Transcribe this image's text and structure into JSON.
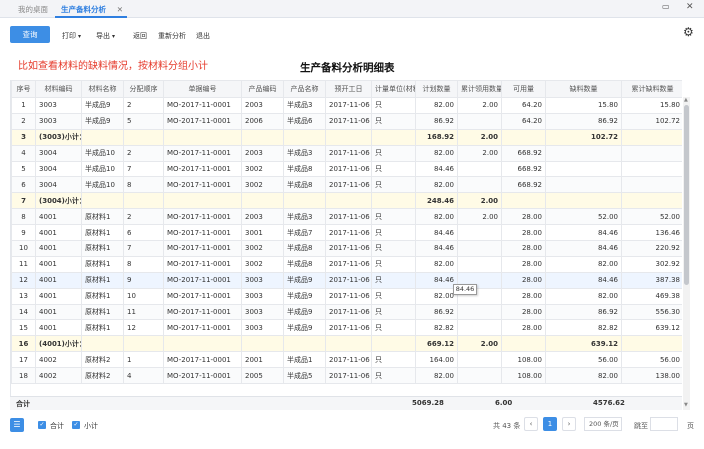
{
  "tabs": {
    "home": "我的桌面",
    "active": "生产备料分析",
    "close": "✕"
  },
  "window": {
    "min": "▭",
    "close": "✕"
  },
  "toolbar": {
    "query": "查询",
    "print": "打印",
    "export": "导出",
    "back": "返回",
    "reanalyze": "重新分析",
    "exit": "退出",
    "gear_icon": "gear-icon"
  },
  "note": "比如查看材料的缺料情况，按材料分组小计",
  "title": "生产备料分析明细表",
  "columns": [
    "序号",
    "材料编码",
    "材料名称",
    "分配顺序",
    "单据编号",
    "产品编码",
    "产品名称",
    "预开工日",
    "计量单位(材料)",
    "计划数量",
    "累计领用数量",
    "可用量",
    "缺料数量",
    "累计缺料数量"
  ],
  "rows": [
    {
      "type": "data",
      "cells": [
        "1",
        "3003",
        "半成品9",
        "2",
        "MO-2017-11-0001",
        "2003",
        "半成品3",
        "2017-11-06",
        "只",
        "82.00",
        "2.00",
        "64.20",
        "15.80",
        "15.80"
      ]
    },
    {
      "type": "data",
      "cells": [
        "2",
        "3003",
        "半成品9",
        "5",
        "MO-2017-11-0001",
        "2006",
        "半成品6",
        "2017-11-06",
        "只",
        "86.92",
        "",
        "64.20",
        "86.92",
        "102.72"
      ]
    },
    {
      "type": "subtotal",
      "cells": [
        "3",
        "(3003)小计：",
        "",
        "",
        "",
        "",
        "",
        "",
        "",
        "168.92",
        "2.00",
        "",
        "102.72",
        ""
      ]
    },
    {
      "type": "data",
      "cells": [
        "4",
        "3004",
        "半成品10",
        "2",
        "MO-2017-11-0001",
        "2003",
        "半成品3",
        "2017-11-06",
        "只",
        "82.00",
        "2.00",
        "668.92",
        "",
        ""
      ]
    },
    {
      "type": "data",
      "cells": [
        "5",
        "3004",
        "半成品10",
        "7",
        "MO-2017-11-0001",
        "3002",
        "半成品8",
        "2017-11-06",
        "只",
        "84.46",
        "",
        "668.92",
        "",
        ""
      ]
    },
    {
      "type": "data",
      "cells": [
        "6",
        "3004",
        "半成品10",
        "8",
        "MO-2017-11-0001",
        "3002",
        "半成品8",
        "2017-11-06",
        "只",
        "82.00",
        "",
        "668.92",
        "",
        ""
      ]
    },
    {
      "type": "subtotal",
      "cells": [
        "7",
        "(3004)小计：",
        "",
        "",
        "",
        "",
        "",
        "",
        "",
        "248.46",
        "2.00",
        "",
        "",
        ""
      ]
    },
    {
      "type": "data",
      "cells": [
        "8",
        "4001",
        "原材料1",
        "2",
        "MO-2017-11-0001",
        "2003",
        "半成品3",
        "2017-11-06",
        "只",
        "82.00",
        "2.00",
        "28.00",
        "52.00",
        "52.00"
      ]
    },
    {
      "type": "data",
      "cells": [
        "9",
        "4001",
        "原材料1",
        "6",
        "MO-2017-11-0001",
        "3001",
        "半成品7",
        "2017-11-06",
        "只",
        "84.46",
        "",
        "28.00",
        "84.46",
        "136.46"
      ]
    },
    {
      "type": "data",
      "cells": [
        "10",
        "4001",
        "原材料1",
        "7",
        "MO-2017-11-0001",
        "3002",
        "半成品8",
        "2017-11-06",
        "只",
        "84.46",
        "",
        "28.00",
        "84.46",
        "220.92"
      ]
    },
    {
      "type": "data",
      "cells": [
        "11",
        "4001",
        "原材料1",
        "8",
        "MO-2017-11-0001",
        "3002",
        "半成品8",
        "2017-11-06",
        "只",
        "82.00",
        "",
        "28.00",
        "82.00",
        "302.92"
      ]
    },
    {
      "type": "hl",
      "cells": [
        "12",
        "4001",
        "原材料1",
        "9",
        "MO-2017-11-0001",
        "3003",
        "半成品9",
        "2017-11-06",
        "只",
        "84.46",
        "",
        "28.00",
        "84.46",
        "387.38"
      ]
    },
    {
      "type": "data",
      "cells": [
        "13",
        "4001",
        "原材料1",
        "10",
        "MO-2017-11-0001",
        "3003",
        "半成品9",
        "2017-11-06",
        "只",
        "82.00",
        "",
        "28.00",
        "82.00",
        "469.38"
      ]
    },
    {
      "type": "data",
      "cells": [
        "14",
        "4001",
        "原材料1",
        "11",
        "MO-2017-11-0001",
        "3003",
        "半成品9",
        "2017-11-06",
        "只",
        "86.92",
        "",
        "28.00",
        "86.92",
        "556.30"
      ]
    },
    {
      "type": "data",
      "cells": [
        "15",
        "4001",
        "原材料1",
        "12",
        "MO-2017-11-0001",
        "3003",
        "半成品9",
        "2017-11-06",
        "只",
        "82.82",
        "",
        "28.00",
        "82.82",
        "639.12"
      ]
    },
    {
      "type": "subtotal",
      "cells": [
        "16",
        "(4001)小计：",
        "",
        "",
        "",
        "",
        "",
        "",
        "",
        "669.12",
        "2.00",
        "",
        "639.12",
        ""
      ]
    },
    {
      "type": "data",
      "cells": [
        "17",
        "4002",
        "原材料2",
        "1",
        "MO-2017-11-0001",
        "2001",
        "半成品1",
        "2017-11-06",
        "只",
        "164.00",
        "",
        "108.00",
        "56.00",
        "56.00"
      ]
    },
    {
      "type": "data",
      "cells": [
        "18",
        "4002",
        "原材料2",
        "4",
        "MO-2017-11-0001",
        "2005",
        "半成品5",
        "2017-11-06",
        "只",
        "82.00",
        "",
        "108.00",
        "82.00",
        "138.00"
      ]
    }
  ],
  "footer": {
    "label": "合计",
    "plan_total": "5069.28",
    "used_total": "6.00",
    "short_total": "4576.62"
  },
  "tooltip": "84.46",
  "bottom": {
    "check_total": "合计",
    "check_subtotal": "小计",
    "count": "共 43 条",
    "page": "1",
    "page_size": "200 条/页",
    "goto": "跳至",
    "page_suffix": "页"
  },
  "colors": {
    "accent": "#3d8ee5",
    "note": "#e53a2b",
    "subtotal_bg": "#fffbe6"
  }
}
